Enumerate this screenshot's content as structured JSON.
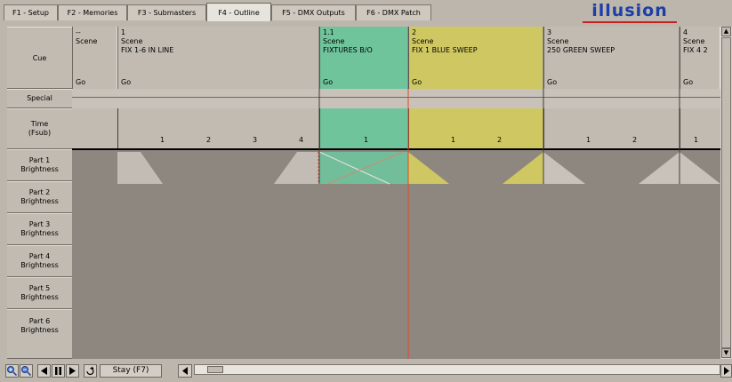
{
  "tabs": [
    {
      "label": "F1 - Setup",
      "active": false
    },
    {
      "label": "F2 - Memories",
      "active": false
    },
    {
      "label": "F3 - Submasters",
      "active": false
    },
    {
      "label": "F4 - Outline",
      "active": true
    },
    {
      "label": "F5 - DMX Outputs",
      "active": false
    },
    {
      "label": "F6 - DMX Patch",
      "active": false
    }
  ],
  "logo_text": "illusion",
  "row_headers": {
    "cue": "Cue",
    "special": "Special",
    "time": [
      "Time",
      "(Fsub)"
    ],
    "parts": [
      [
        "Part 1",
        "Brightness"
      ],
      [
        "Part 2",
        "Brightness"
      ],
      [
        "Part 3",
        "Brightness"
      ],
      [
        "Part 4",
        "Brightness"
      ],
      [
        "Part 5",
        "Brightness"
      ],
      [
        "Part 6",
        "Brightness"
      ]
    ]
  },
  "cues": [
    {
      "number": "--",
      "type": "Scene",
      "name": "",
      "action": "Go",
      "color": "#c2bbb2"
    },
    {
      "number": "1",
      "type": "Scene",
      "name": "FIX 1-6 IN LINE",
      "action": "Go",
      "color": "#c2bbb2"
    },
    {
      "number": "1.1",
      "type": "Scene",
      "name": "FIXTURES B/O",
      "action": "Go",
      "color": "#6fc49c"
    },
    {
      "number": "2",
      "type": "Scene",
      "name": "FIX 1 BLUE SWEEP",
      "action": "Go",
      "color": "#cfc862"
    },
    {
      "number": "3",
      "type": "Scene",
      "name": "250 GREEN SWEEP",
      "action": "Go",
      "color": "#c2bbb2"
    },
    {
      "number": "4",
      "type": "Scene",
      "name": "FIX 4 2",
      "action": "Go",
      "color": "#c2bbb2"
    }
  ],
  "time_ticks": {
    "cue1": [
      "1",
      "2",
      "3",
      "4"
    ],
    "cue11": [
      "1"
    ],
    "cue2": [
      "1",
      "2"
    ],
    "cue3": [
      "1",
      "2"
    ],
    "cue4": [
      "1"
    ]
  },
  "toolbar": {
    "zoom_in_icon": "magnifier-plus",
    "zoom_out_icon": "magnifier-minus",
    "rewind_icon": "rewind",
    "pause_icon": "pause",
    "play_icon": "play",
    "loop_icon": "loop",
    "stay_label": "Stay (F7)"
  },
  "colors": {
    "background": "#bdb6ad",
    "panel": "#8d8780",
    "green_cue": "#6fc49c",
    "yellow_cue": "#cfc862",
    "playhead": "#e04a2a",
    "logo_blue": "#1d3ea6",
    "logo_red": "#c61f1f"
  }
}
